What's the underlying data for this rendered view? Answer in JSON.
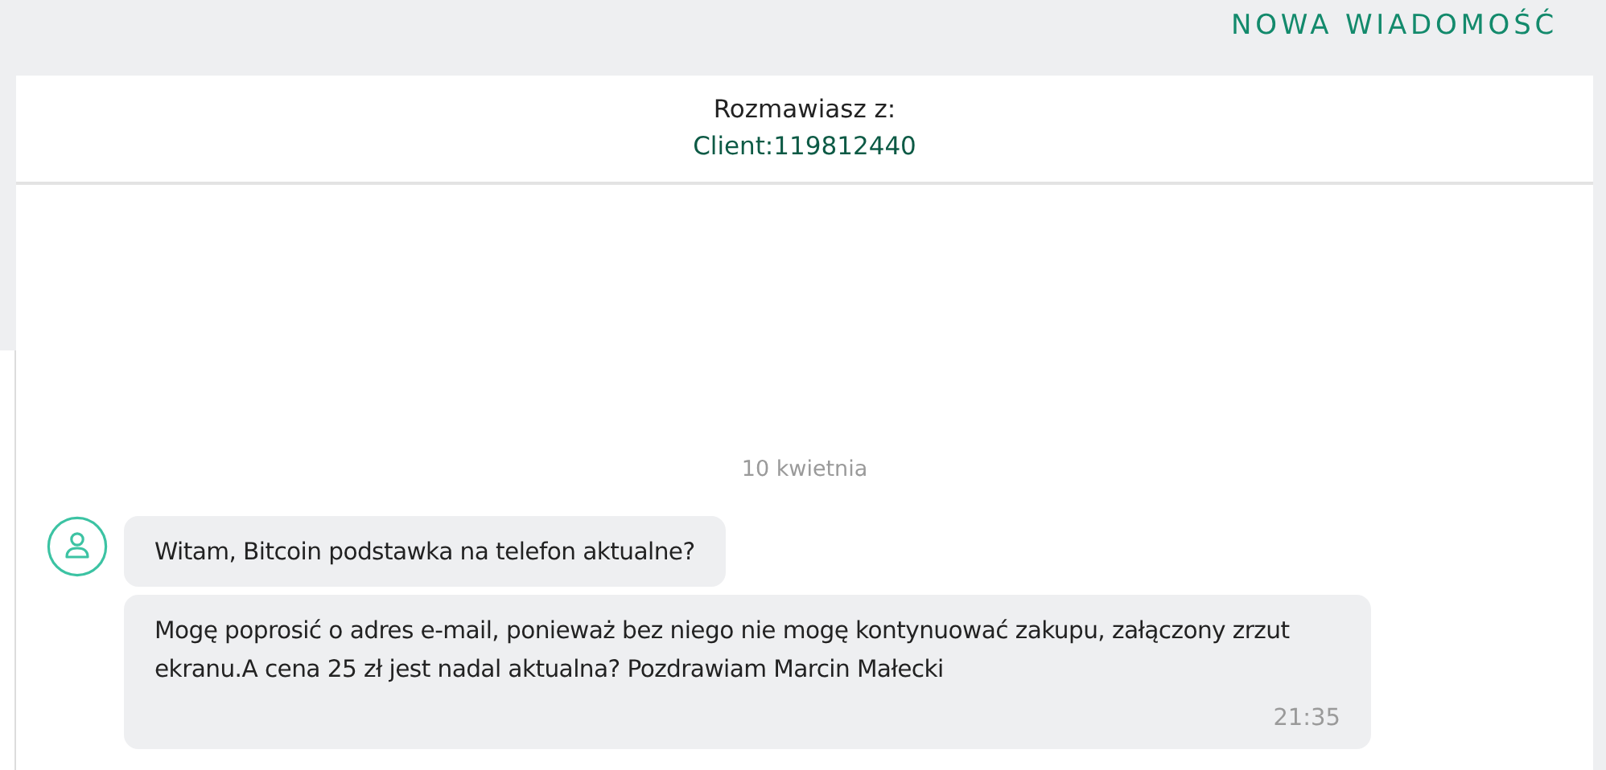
{
  "top_bar": {
    "new_message_button": "NOWA WIADOMOŚĆ"
  },
  "conversation_header": {
    "label": "Rozmawiasz z:",
    "contact": "Client:119812440"
  },
  "date_separator": "10 kwietnia",
  "messages": [
    {
      "text": "Witam, Bitcoin podstawka na telefon aktualne?"
    },
    {
      "text": "Mogę poprosić o adres e-mail, ponieważ bez niego nie mogę kontynuować zakupu, załączony zrzut ekranu.A cena 25 zł jest nadal aktualna? Pozdrawiam Marcin Małecki",
      "time": "21:35"
    }
  ]
}
